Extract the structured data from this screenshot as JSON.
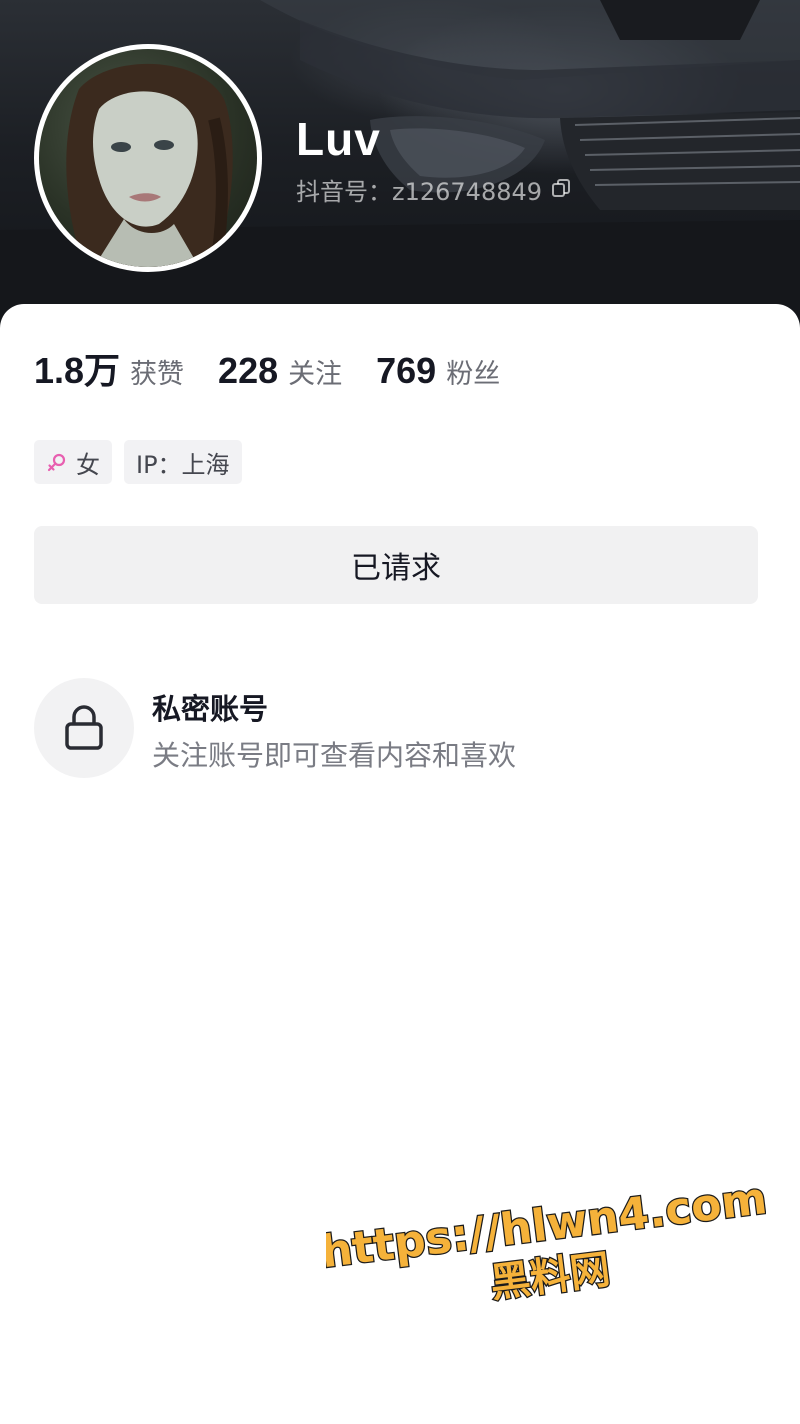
{
  "profile": {
    "nickname": "Luv",
    "douyin_id_label": "抖音号：z126748849"
  },
  "stats": [
    {
      "value": "1.8万",
      "label": "获赞"
    },
    {
      "value": "228",
      "label": "关注"
    },
    {
      "value": "769",
      "label": "粉丝"
    }
  ],
  "tags": {
    "gender": "女",
    "ip": "IP：上海"
  },
  "action": {
    "request_label": "已请求"
  },
  "private_notice": {
    "title": "私密账号",
    "description": "关注账号即可查看内容和喜欢"
  },
  "icons": {
    "copy": "copy-icon",
    "gender": "female-icon",
    "lock": "lock-icon"
  },
  "colors": {
    "text_primary": "#161823",
    "text_secondary": "#7a7c84",
    "female": "#e85fb0",
    "watermark_fill": "#f5b23a"
  },
  "watermark": {
    "line1": "https://hlwn4.com",
    "line2": "黑料网"
  }
}
